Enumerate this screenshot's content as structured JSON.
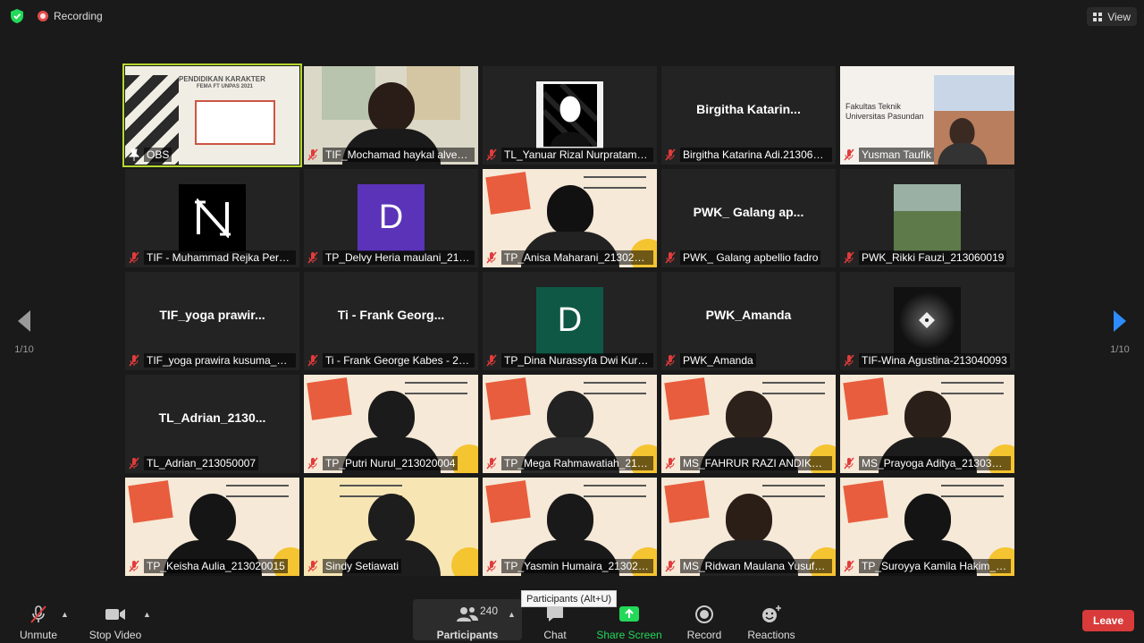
{
  "top": {
    "recording_label": "Recording",
    "view_label": "View"
  },
  "nav": {
    "page_left": "1/10",
    "page_right": "1/10"
  },
  "tiles": [
    {
      "name": "OBS",
      "kind": "video"
    },
    {
      "name": "TIF_Mochamad haykal alvegio...",
      "kind": "video"
    },
    {
      "name": "TL_Yanuar Rizal Nurpratama_...",
      "kind": "video"
    },
    {
      "name": "Birgitha Katarina Adi.2130600...",
      "center": "Birgitha  Katarin...",
      "kind": "name"
    },
    {
      "name": "Yusman Taufik",
      "kind": "video"
    },
    {
      "name": "TIF - Muhammad Rejka Perm...",
      "kind": "video"
    },
    {
      "name": "TP_Delvy Heria maulani_21302...",
      "avatar": "D",
      "kind": "avatar"
    },
    {
      "name": "TP_Anisa Maharani_213020078",
      "kind": "video"
    },
    {
      "name": "PWK_ Galang apbellio fadro",
      "center": "PWK_ Galang  ap...",
      "kind": "name"
    },
    {
      "name": "PWK_Rikki Fauzi_213060019",
      "kind": "video"
    },
    {
      "name": "TIF_yoga prawira kusuma_213...",
      "center": "TIF_yoga  prawir...",
      "kind": "name"
    },
    {
      "name": "Ti - Frank George Kabes - 21...",
      "center": "Ti - Frank  Georg...",
      "kind": "name"
    },
    {
      "name": "TP_Dina Nurassyfa Dwi Kurnia...",
      "avatar": "D",
      "kind": "avatar"
    },
    {
      "name": "PWK_Amanda",
      "center": "PWK_Amanda",
      "kind": "name"
    },
    {
      "name": "TIF-Wina Agustina-213040093",
      "kind": "video"
    },
    {
      "name": "TL_Adrian_213050007",
      "center": "TL_Adrian_2130...",
      "kind": "name"
    },
    {
      "name": "TP_Putri Nurul_213020004",
      "kind": "video"
    },
    {
      "name": "TP_Mega Rahmawatiah_21302...",
      "kind": "video"
    },
    {
      "name": "MS_FAHRUR RAZI ANDIKA_21...",
      "kind": "video"
    },
    {
      "name": "MS_Prayoga Aditya_213030033",
      "kind": "video"
    },
    {
      "name": "TP_Keisha Aulia_213020015",
      "kind": "video"
    },
    {
      "name": "Sindy Setiawati",
      "kind": "video"
    },
    {
      "name": "TP_Yasmin Humaira_213020028",
      "kind": "video"
    },
    {
      "name": "MS_Ridwan Maulana Yusuf_21...",
      "kind": "video"
    },
    {
      "name": "TP_Suroyya Kamila Hakim_213...",
      "kind": "video"
    }
  ],
  "colors": {
    "accent_green": "#23d959",
    "leave_red": "#d93a3a",
    "active_border": "#b6d92e",
    "avatar_purple": "#5a33b8",
    "avatar_teal": "#0f5846"
  },
  "tooltip": "Participants (Alt+U)",
  "toolbar": {
    "unmute": "Unmute",
    "stop_video": "Stop Video",
    "participants": "Participants",
    "participants_count": "240",
    "chat": "Chat",
    "share_screen": "Share Screen",
    "record": "Record",
    "reactions": "Reactions",
    "leave": "Leave"
  },
  "obs_slide": {
    "title": "PENDIDIKAN KARAKTER",
    "subtitle": "FEMA FT UNPAS 2021"
  },
  "campus_slide": {
    "line1": "Fakultas Teknik",
    "line2": "Universitas Pasundan"
  }
}
